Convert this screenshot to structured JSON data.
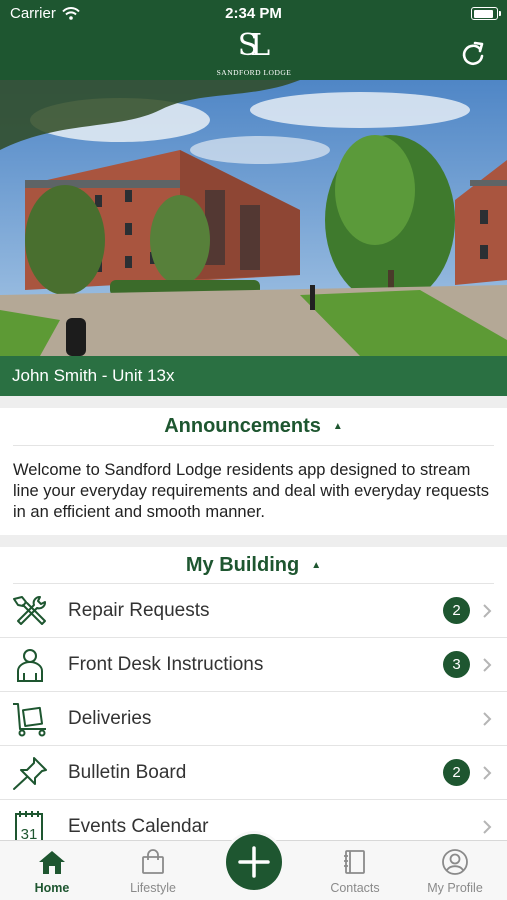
{
  "status_bar": {
    "carrier": "Carrier",
    "time": "2:34 PM"
  },
  "header": {
    "logo_monogram": "SL",
    "logo_text": "SANDFORD LODGE"
  },
  "user": {
    "name_unit": "John Smith - Unit 13x"
  },
  "announcements": {
    "title": "Announcements",
    "text": "Welcome to Sandford Lodge residents app designed to stream line your everyday requirements and deal with everyday requests in an efficient and smooth manner."
  },
  "building": {
    "title": "My Building",
    "items": [
      {
        "label": "Repair Requests",
        "badge": "2",
        "icon": "repair-tools-icon"
      },
      {
        "label": "Front Desk Instructions",
        "badge": "3",
        "icon": "person-icon"
      },
      {
        "label": "Deliveries",
        "badge": "",
        "icon": "trolley-icon"
      },
      {
        "label": "Bulletin Board",
        "badge": "2",
        "icon": "pushpin-icon"
      },
      {
        "label": "Events Calendar",
        "badge": "",
        "icon": "calendar-icon",
        "icon_text": "31"
      }
    ]
  },
  "tabs": [
    {
      "label": "Home",
      "icon": "home-icon",
      "active": true
    },
    {
      "label": "Lifestyle",
      "icon": "shopping-bag-icon",
      "active": false
    },
    {
      "label": "",
      "icon": "plus-icon",
      "active": false
    },
    {
      "label": "Contacts",
      "icon": "contacts-book-icon",
      "active": false
    },
    {
      "label": "My Profile",
      "icon": "profile-icon",
      "active": false
    }
  ],
  "colors": {
    "brand": "#1e5630",
    "user_bar": "#2a7042",
    "badge": "#1e5630"
  }
}
